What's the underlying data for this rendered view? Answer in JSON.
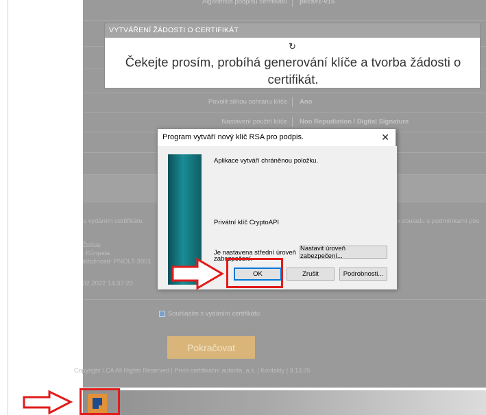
{
  "background_page": {
    "rows": [
      {
        "label": "Algoritmus podpisu certifikátu",
        "value": "pkcs#1-v15"
      },
      {
        "label": "Povolit silnou ochranu klíče",
        "value": "Ano"
      },
      {
        "label": "Nastavení použití klíče",
        "value": "Non Repudiation / Digital Signature"
      }
    ],
    "left_text_consent": "ím s vydáním certifikátu",
    "right_text_consent": "v souladu s podmínkami pos",
    "person_lines": [
      "Žošua",
      ": Kūnpala",
      "totožnosti: PNOLT-3901"
    ],
    "date_text": "02.2022 14:37:20",
    "consent_checkbox_label": "Souhlasím s vydáním certifikátu",
    "continue_button": "Pokračovat",
    "footer": "Copyright I.CA All Rights Reserved | První certifikační autorita, a.s. | Kontakty | 9.13.05"
  },
  "progress_panel": {
    "title": "VYTVÁŘENÍ ŽÁDOSTI O CERTIFIKÁT",
    "spinner_icon": "loading-spinner-icon",
    "message": "Čekejte prosím, probíhá generování klíče a tvorba žádosti o certifikát."
  },
  "dialog": {
    "title": "Program vytváří nový klíč RSA pro podpis.",
    "close_glyph": "✕",
    "line1": "Aplikace vytváří chráněnou položku.",
    "line2": "Privátní klíč CryptoAPI",
    "level_line1": "Je nastavena střední úroveň",
    "level_line2": "zabezpečení.",
    "set_level_button": "Nastavit úroveň zabezpečení...",
    "ok_button": "OK",
    "cancel_button": "Zrušit",
    "details_button": "Podrobnosti..."
  },
  "colors": {
    "annotation_red": "#e11b1b",
    "dialog_banner_teal": "#1a8d94",
    "cta_orange": "#d9b579",
    "logo_orange": "#e1913a",
    "logo_blue": "#1d4b8c"
  }
}
